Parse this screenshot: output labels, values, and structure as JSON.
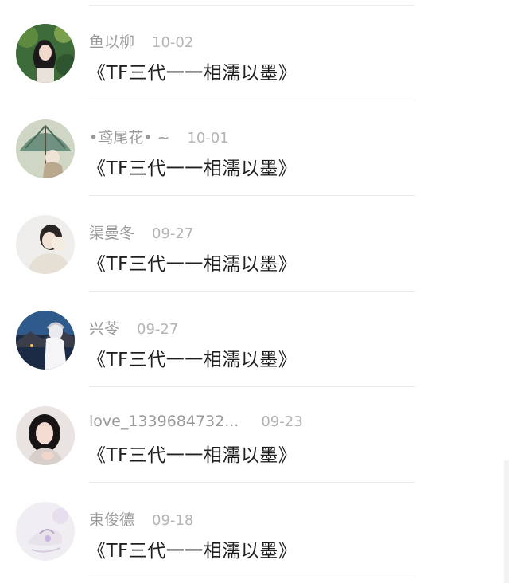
{
  "comments": [
    {
      "username": "鱼以柳",
      "date": "10-02",
      "message": "《TF三代一一相濡以墨》",
      "avatar": "girl-green-avatar"
    },
    {
      "username": "•鸢尾花• ~",
      "date": "10-01",
      "message": "《TF三代一一相濡以墨》",
      "avatar": "umbrella-girl-avatar"
    },
    {
      "username": "渠曼冬",
      "date": "09-27",
      "message": "《TF三代一一相濡以墨》",
      "avatar": "earmuff-girl-avatar"
    },
    {
      "username": "兴苓",
      "date": "09-27",
      "message": "《TF三代一一相濡以墨》",
      "avatar": "anime-night-avatar"
    },
    {
      "username": "love_1339684732...",
      "date": "09-23",
      "message": "《TF三代一一相濡以墨》",
      "avatar": "portrait-girl-avatar"
    },
    {
      "username": "束俊德",
      "date": "09-18",
      "message": "《TF三代一一相濡以墨》",
      "avatar": "pastel-shoe-avatar"
    }
  ],
  "colors": {
    "username": "#9a9a9a",
    "date": "#b3b3b3",
    "message": "#1f1f1f",
    "divider": "#ececec"
  }
}
